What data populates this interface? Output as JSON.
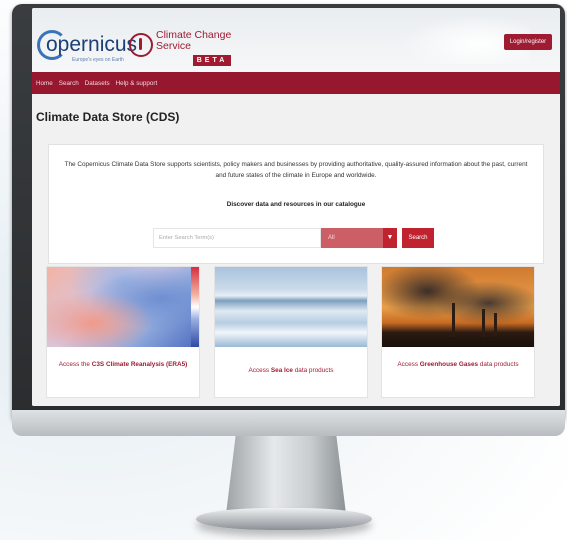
{
  "header": {
    "copernicus_logo_text": "opernicus",
    "copernicus_tagline": "Europe's eyes on Earth",
    "c3s_title_line1": "Climate Change",
    "c3s_title_line2": "Service",
    "beta_label": "BETA",
    "login_label": "Login/register"
  },
  "nav": {
    "items": [
      {
        "label": "Home"
      },
      {
        "label": "Search"
      },
      {
        "label": "Datasets"
      },
      {
        "label": "Help & support"
      }
    ]
  },
  "page": {
    "title": "Climate Data Store (CDS)",
    "intro": "The Copernicus Climate Data Store supports scientists, policy makers and businesses by providing authoritative, quality-assured information about the past, current and future states of the climate in Europe and worldwide.",
    "discover": "Discover data and resources in our catalogue"
  },
  "search": {
    "placeholder": "Enter Search Term(s)",
    "select_value": "All",
    "button_label": "Search"
  },
  "cards": [
    {
      "prefix": "Access the ",
      "bold": "C3S Climate Reanalysis (ERA5)",
      "suffix": ""
    },
    {
      "prefix": "Access ",
      "bold": "Sea Ice",
      "suffix": " data products"
    },
    {
      "prefix": "Access ",
      "bold": "Greenhouse Gases",
      "suffix": " data products"
    }
  ],
  "colors": {
    "brand_red": "#96172e",
    "button_red": "#c0232f",
    "copernicus_blue": "#1d3f77"
  }
}
